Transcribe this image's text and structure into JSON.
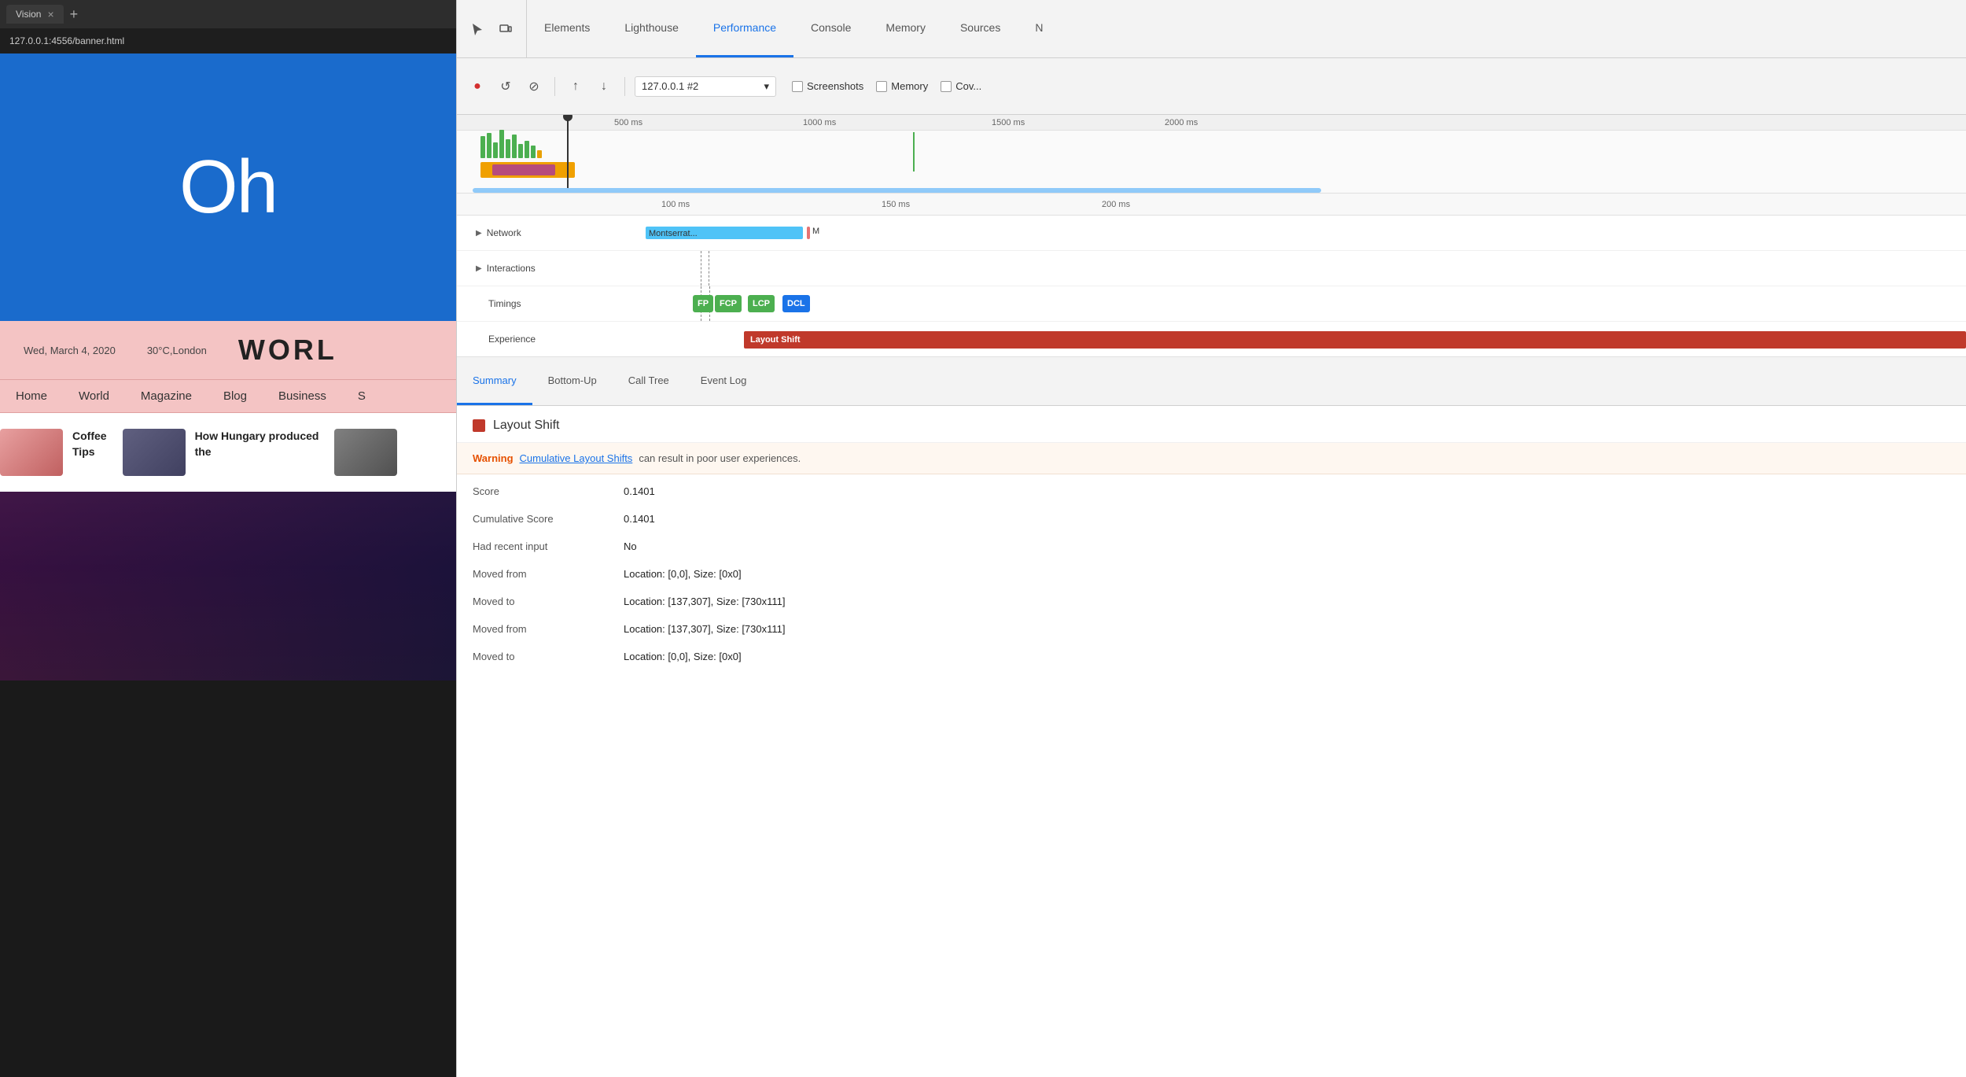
{
  "browser": {
    "tab_title": "Vision",
    "address": "127.0.0.1:4556/banner.html",
    "new_tab_icon": "+"
  },
  "webpage": {
    "hero_text": "Oh",
    "date": "Wed, March 4, 2020",
    "location": "30°C,London",
    "world_title": "WORL",
    "nav_items": [
      "Home",
      "World",
      "Magazine",
      "Blog",
      "Business",
      "S"
    ],
    "news_cards": [
      {
        "title": "Coffee Tips"
      },
      {
        "title": "How Hungary produced the"
      }
    ]
  },
  "devtools": {
    "tabs": [
      "Elements",
      "Lighthouse",
      "Performance",
      "Console",
      "Memory",
      "Sources",
      "N"
    ],
    "active_tab": "Performance",
    "toolbar": {
      "record_label": "●",
      "reload_label": "↺",
      "clear_label": "⊘",
      "upload_label": "↑",
      "download_label": "↓",
      "target": "127.0.0.1 #2",
      "screenshots_label": "Screenshots",
      "memory_label": "Memory",
      "coverage_label": "Cov..."
    },
    "ruler": {
      "marks": [
        "500 ms",
        "1000 ms",
        "1500 ms",
        "2000 ms"
      ]
    },
    "detail_ruler": {
      "marks": [
        "100 ms",
        "150 ms",
        "200 ms"
      ]
    },
    "tracks": {
      "network": {
        "label": "Network",
        "bar_label": "Montserrat..."
      },
      "interactions": {
        "label": "Interactions"
      },
      "timings": {
        "label": "Timings",
        "badges": [
          "FP",
          "FCP",
          "LCP",
          "DCL"
        ]
      },
      "experience": {
        "label": "Experience",
        "bar_label": "Layout Shift"
      }
    },
    "bottom_tabs": [
      "Summary",
      "Bottom-Up",
      "Call Tree",
      "Event Log"
    ],
    "active_bottom_tab": "Summary",
    "detail": {
      "title": "Layout Shift",
      "warning_label": "Warning",
      "warning_link": "Cumulative Layout Shifts",
      "warning_text": "can result in poor user experiences.",
      "rows": [
        {
          "key": "Score",
          "value": "0.1401"
        },
        {
          "key": "Cumulative Score",
          "value": "0.1401"
        },
        {
          "key": "Had recent input",
          "value": "No"
        },
        {
          "key": "Moved from",
          "value": "Location: [0,0], Size: [0x0]"
        },
        {
          "key": "Moved to",
          "value": "Location: [137,307], Size: [730x111]"
        },
        {
          "key": "Moved from",
          "value": "Location: [137,307], Size: [730x111]"
        },
        {
          "key": "Moved to",
          "value": "Location: [0,0], Size: [0x0]"
        }
      ]
    }
  }
}
